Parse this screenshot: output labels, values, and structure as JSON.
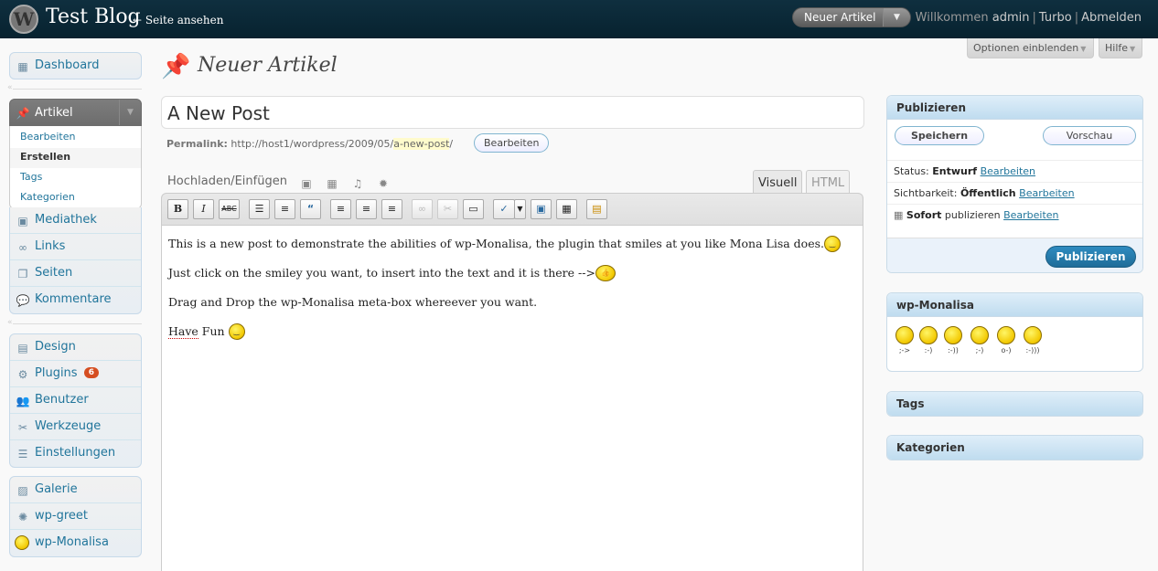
{
  "header": {
    "site_title": "Test Blog",
    "view_site": "← Seite ansehen",
    "favorite_action": "Neuer Artikel",
    "user_greeting": "Willkommen",
    "user_name": "admin",
    "turbo": "Turbo",
    "logout": "Abmelden"
  },
  "screen_meta": {
    "options": "Optionen einblenden",
    "help": "Hilfe"
  },
  "menu": {
    "dashboard": "Dashboard",
    "posts": {
      "label": "Artikel",
      "submenu": [
        "Bearbeiten",
        "Erstellen",
        "Tags",
        "Kategorien"
      ]
    },
    "group2": [
      "Mediathek",
      "Links",
      "Seiten",
      "Kommentare"
    ],
    "group3": [
      "Design",
      "Plugins",
      "Benutzer",
      "Werkzeuge",
      "Einstellungen"
    ],
    "plugin_updates": "6",
    "group4": [
      "Galerie",
      "wp-greet",
      "wp-Monalisa"
    ]
  },
  "page": {
    "title": "Neuer Artikel"
  },
  "post": {
    "title_value": "A New Post",
    "permalink_label": "Permalink:",
    "permalink_base": "http://host1/wordpress/2009/05/",
    "permalink_slug": "a-new-post",
    "permalink_trailing": "/",
    "permalink_edit": "Bearbeiten"
  },
  "editor": {
    "media_label": "Hochladen/Einfügen",
    "tab_visual": "Visuell",
    "tab_html": "HTML",
    "toolbar": [
      "B",
      "I",
      "ABC"
    ],
    "paragraphs": [
      "This is a new post to demonstrate the abilities of wp-Monalisa, the plugin that smiles at you like Mona Lisa does.",
      "Just click on the smiley you want, to insert into the text and it is there -->",
      "Drag and Drop the wp-Monalisa meta-box whereever you want."
    ],
    "last_word1": "Have",
    "last_word2": "Fun"
  },
  "publish": {
    "title": "Publizieren",
    "save": "Speichern",
    "preview": "Vorschau",
    "status_label": "Status:",
    "status_value": "Entwurf",
    "visibility_label": "Sichtbarkeit:",
    "visibility_value": "Öffentlich",
    "schedule_value": "Sofort",
    "schedule_text": "publizieren",
    "edit": "Bearbeiten",
    "publish": "Publizieren"
  },
  "monalisa": {
    "title": "wp-Monalisa",
    "smilies": [
      ";->",
      ":-)",
      ":-))",
      ";-)",
      "o-)",
      ":-)))"
    ]
  },
  "boxes": {
    "tags": "Tags",
    "categories": "Kategorien"
  }
}
